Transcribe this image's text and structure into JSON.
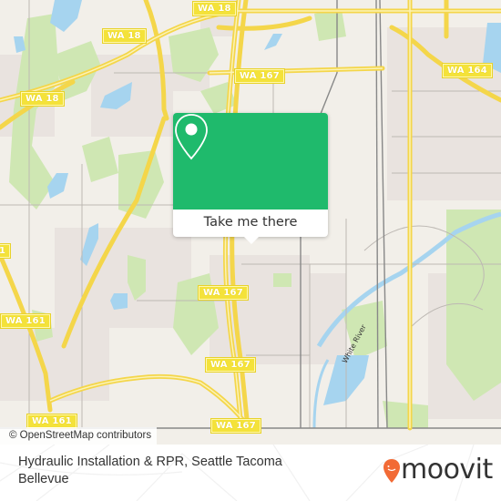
{
  "map": {
    "road_labels": [
      {
        "id": "wa18-a",
        "text": "WA 18"
      },
      {
        "id": "wa18-b",
        "text": "WA 18"
      },
      {
        "id": "wa18-c",
        "text": "WA 18"
      },
      {
        "id": "wa167-a",
        "text": "WA 167"
      },
      {
        "id": "wa164",
        "text": "WA 164"
      },
      {
        "id": "wa167-b",
        "text": "WA 167"
      },
      {
        "id": "wa167-c",
        "text": "WA 167"
      },
      {
        "id": "wa161-a",
        "text": "WA 161"
      },
      {
        "id": "wa161-b",
        "text": "WA 161"
      },
      {
        "id": "wa167-d",
        "text": "WA 167"
      },
      {
        "id": "wa1-edge",
        "text": "1"
      }
    ],
    "river_label": "White River",
    "attribution": "© OpenStreetMap contributors",
    "colors": {
      "land": "#f2efe9",
      "residential": "#e9e3df",
      "park": "#cfe7b3",
      "water": "#a6d4ef",
      "highway": "#f6e27b",
      "rail": "#888888"
    }
  },
  "popup": {
    "icon": "location-pin-icon",
    "button_label": "Take me there",
    "accent_color": "#1fba6c"
  },
  "footer": {
    "place_name": "Hydraulic Installation & RPR, Seattle Tacoma Bellevue",
    "brand": "moovit",
    "brand_color": "#f26a35"
  }
}
